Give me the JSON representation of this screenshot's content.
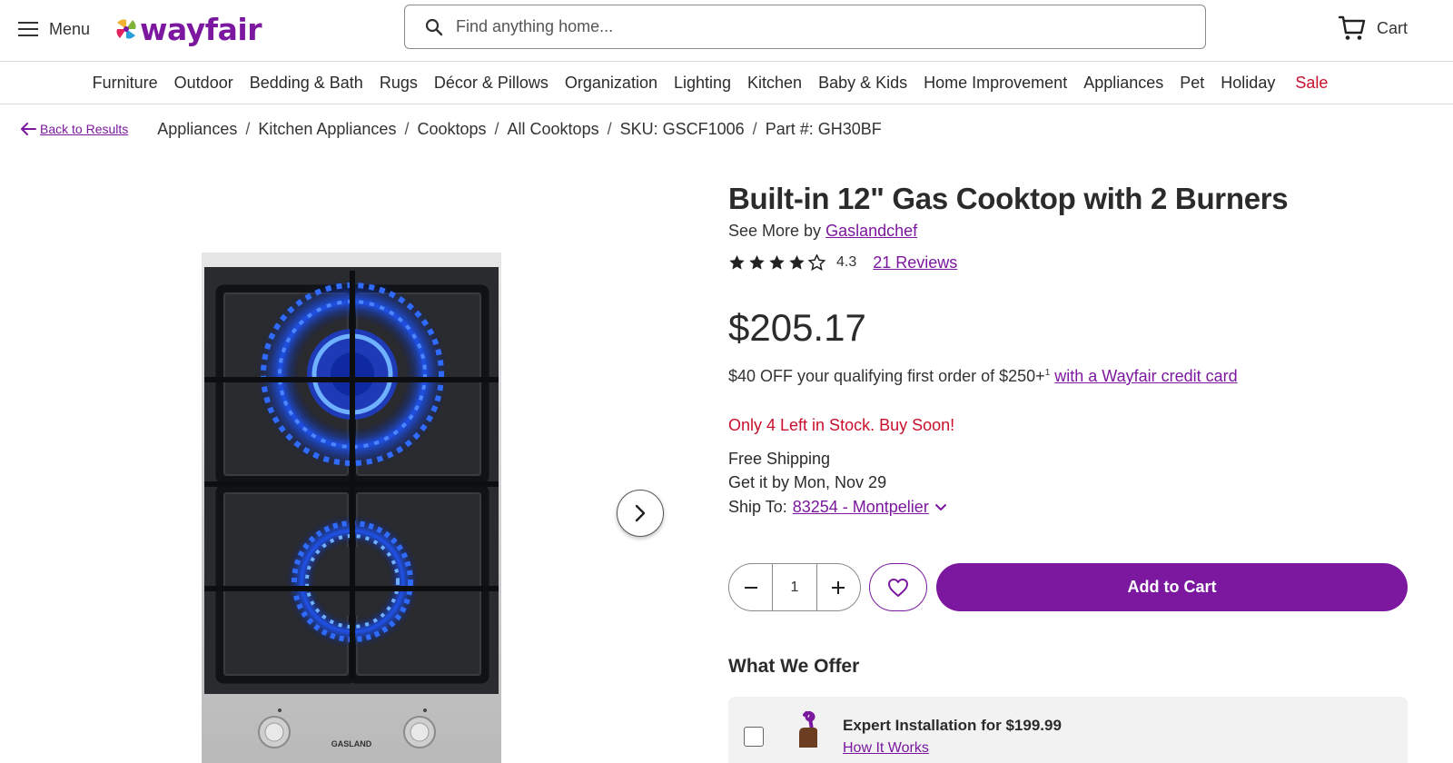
{
  "header": {
    "menu_label": "Menu",
    "logo_text": "wayfair",
    "search_placeholder": "Find anything home...",
    "cart_label": "Cart"
  },
  "categories": [
    "Furniture",
    "Outdoor",
    "Bedding & Bath",
    "Rugs",
    "Décor & Pillows",
    "Organization",
    "Lighting",
    "Kitchen",
    "Baby & Kids",
    "Home Improvement",
    "Appliances",
    "Pet",
    "Holiday",
    "Sale"
  ],
  "breadcrumb": {
    "back_label": "Back to Results",
    "items": [
      "Appliances",
      "Kitchen Appliances",
      "Cooktops",
      "All Cooktops",
      "SKU: GSCF1006",
      "Part #: GH30BF"
    ],
    "separator": "/"
  },
  "gallery": {
    "brand_mark": "GASLAND"
  },
  "product": {
    "title": "Built-in 12\" Gas Cooktop with 2 Burners",
    "see_more_prefix": "See More by",
    "brand": "Gaslandchef",
    "rating": "4.3",
    "rating_value": 4.3,
    "rating_max": 5,
    "reviews": "21 Reviews",
    "price": "$205.17",
    "promo_text": "$40 OFF your qualifying first order of $250+",
    "promo_sup": "1",
    "promo_link": "with a Wayfair credit card",
    "stock": "Only 4 Left in Stock. Buy Soon!",
    "shipping": "Free Shipping",
    "delivery": "Get it by Mon, Nov 29",
    "ship_to_label": "Ship To:",
    "ship_to_value": "83254 - Montpelier"
  },
  "purchase": {
    "quantity": "1",
    "add_to_cart": "Add to Cart"
  },
  "offer": {
    "heading": "What We Offer",
    "item_title": "Expert Installation for $199.99",
    "item_sub": "How It Works"
  },
  "colors": {
    "brand_purple": "#7b189f",
    "sale_red": "#c8102e",
    "stock_red": "#c8102e"
  }
}
